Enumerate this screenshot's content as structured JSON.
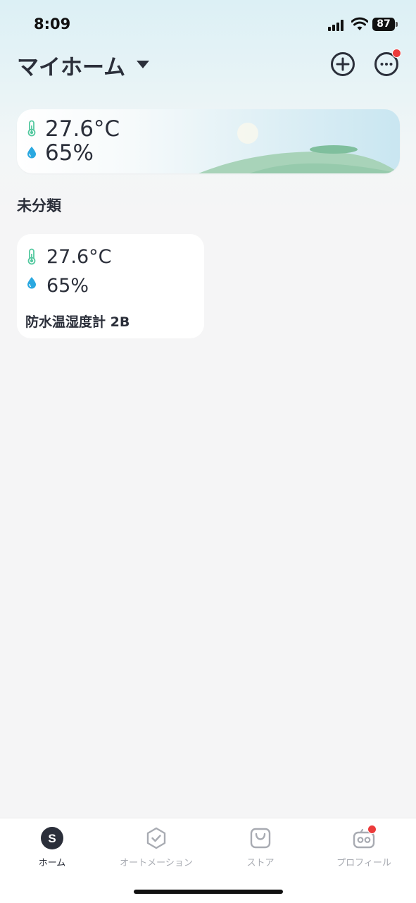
{
  "status_bar": {
    "time": "8:09",
    "battery": "87"
  },
  "header": {
    "home_name": "マイホーム"
  },
  "weather": {
    "temperature": "27.6°C",
    "humidity": "65%"
  },
  "section": {
    "label": "未分類"
  },
  "device": {
    "temperature": "27.6°C",
    "humidity": "65%",
    "name": "防水温湿度計 2B"
  },
  "tabs": [
    {
      "label": "ホーム",
      "icon": "home-s-icon",
      "active": true
    },
    {
      "label": "オートメーション",
      "icon": "automation-shield-icon"
    },
    {
      "label": "ストア",
      "icon": "store-bag-icon"
    },
    {
      "label": "プロフィール",
      "icon": "profile-bot-icon"
    }
  ],
  "colors": {
    "accent_green": "#55c9a0",
    "accent_blue": "#2aa8e0",
    "badge_red": "#ec3b3b",
    "text_dark": "#2b2f3a"
  }
}
